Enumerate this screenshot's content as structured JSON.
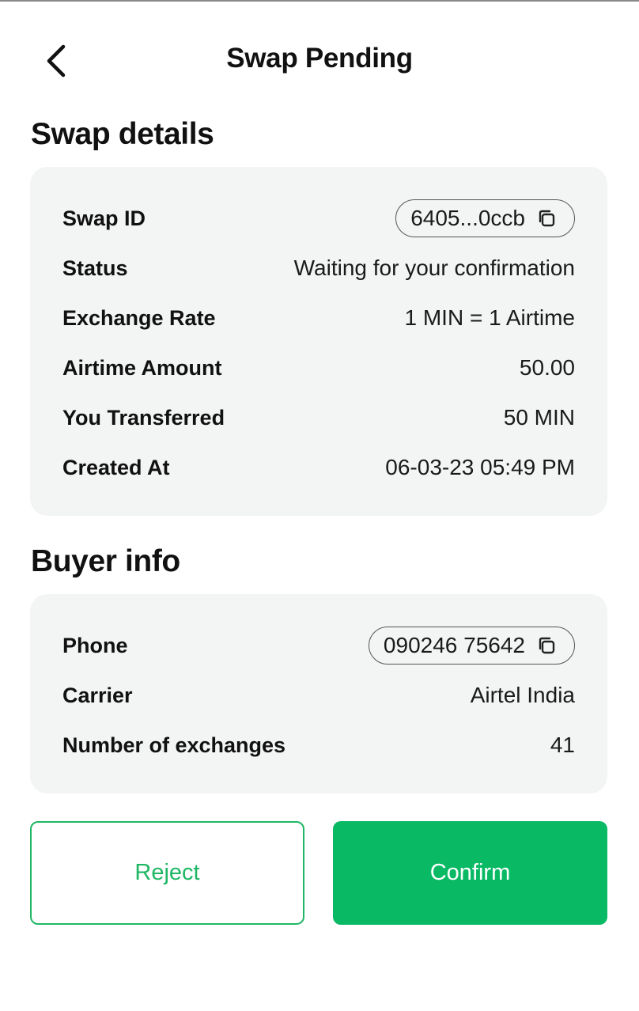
{
  "header": {
    "title": "Swap Pending",
    "back_icon": "chevron-left-icon"
  },
  "swap_details": {
    "title": "Swap details",
    "rows": [
      {
        "label": "Swap ID",
        "value": "6405...0ccb",
        "copy_icon": "copy-icon"
      },
      {
        "label": "Status",
        "value": "Waiting for your confirmation"
      },
      {
        "label": "Exchange Rate",
        "value": "1 MIN = 1 Airtime"
      },
      {
        "label": "Airtime Amount",
        "value": "50.00"
      },
      {
        "label": "You Transferred",
        "value": "50 MIN"
      },
      {
        "label": "Created At",
        "value": "06-03-23 05:49 PM"
      }
    ]
  },
  "buyer_info": {
    "title": "Buyer info",
    "rows": [
      {
        "label": "Phone",
        "value": "090246 75642",
        "copy_icon": "copy-icon"
      },
      {
        "label": "Carrier",
        "value": "Airtel India"
      },
      {
        "label": "Number of exchanges",
        "value": "41"
      }
    ]
  },
  "actions": {
    "reject_label": "Reject",
    "confirm_label": "Confirm"
  },
  "colors": {
    "accent": "#09b964",
    "card_background": "#f3f4f4"
  }
}
